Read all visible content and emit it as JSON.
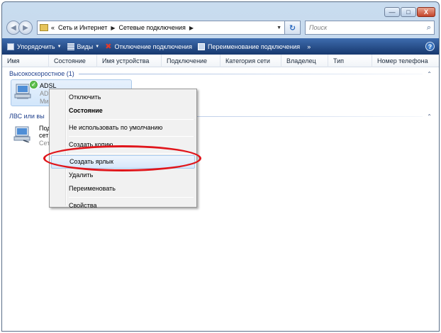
{
  "window": {
    "caption_minimize": "—",
    "caption_maximize": "□",
    "caption_close": "X"
  },
  "address": {
    "prefix": "«",
    "crumbs": [
      "Сеть и Интернет",
      "Сетевые подключения"
    ],
    "search_placeholder": "Поиск"
  },
  "toolbar": {
    "organize": "Упорядочить",
    "views": "Виды",
    "disconnect": "Отключение подключения",
    "rename": "Переименование подключения",
    "more": "»",
    "help": "?"
  },
  "columns": [
    "Имя",
    "Состояние",
    "Имя устройства",
    "Подключение",
    "Категория сети",
    "Владелец",
    "Тип",
    "Номер телефона"
  ],
  "groups": {
    "broadband": {
      "title": "Высокоскоростное (1)",
      "item": {
        "name": "ADSL",
        "line2": "ADS",
        "line3": "Ми"
      }
    },
    "lan": {
      "title": "ЛВС или вы",
      "item": {
        "line1": "Под",
        "line2": "сет",
        "line3": "Сет"
      }
    }
  },
  "context_menu": {
    "disconnect": "Отключить",
    "status": "Состояние",
    "not_default": "Не использовать по умолчанию",
    "copy": "Создать копию",
    "shortcut": "Создать ярлык",
    "delete": "Удалить",
    "rename": "Переименовать",
    "properties": "Свойства"
  },
  "colors": {
    "toolbar": "#2a5191",
    "highlight_ellipse": "#e0151b",
    "group_text": "#1e3f8c"
  }
}
